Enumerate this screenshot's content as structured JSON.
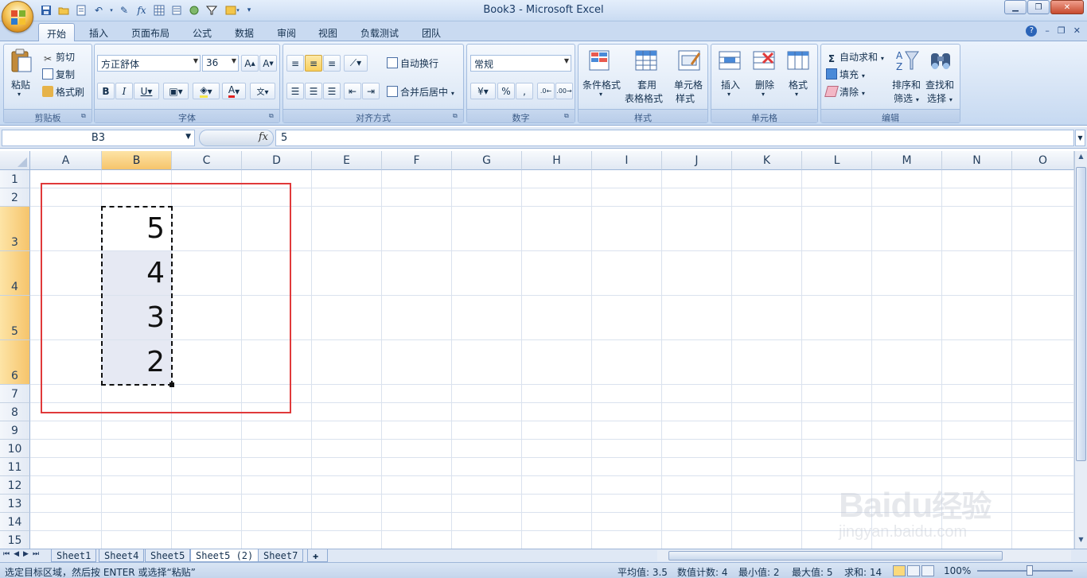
{
  "window": {
    "title": "Book3 - Microsoft Excel"
  },
  "tabs": [
    "开始",
    "插入",
    "页面布局",
    "公式",
    "数据",
    "审阅",
    "视图",
    "负载测试",
    "团队"
  ],
  "clipboard": {
    "paste": "粘贴",
    "cut": "剪切",
    "copy": "复制",
    "format_painter": "格式刷",
    "label": "剪贴板"
  },
  "font": {
    "name": "方正舒体",
    "size": "36",
    "label": "字体"
  },
  "alignment": {
    "wrap": "自动换行",
    "merge": "合并后居中",
    "label": "对齐方式"
  },
  "number": {
    "format": "常规",
    "percent": "%",
    "comma": ",",
    "label": "数字"
  },
  "styles": {
    "conditional": "条件格式",
    "table1": "套用",
    "table2": "表格格式",
    "cell1": "单元格",
    "cell2": "样式",
    "label": "样式"
  },
  "cells": {
    "insert": "插入",
    "delete": "删除",
    "format": "格式",
    "label": "单元格"
  },
  "editing": {
    "autosum": "自动求和",
    "fill": "填充",
    "clear": "清除",
    "sort1": "排序和",
    "sort2": "筛选",
    "find1": "查找和",
    "find2": "选择",
    "label": "编辑"
  },
  "formula_bar": {
    "name_box": "B3",
    "fx": "fx",
    "value": "5"
  },
  "columns": [
    "A",
    "B",
    "C",
    "D",
    "E",
    "F",
    "G",
    "H",
    "I",
    "J",
    "K",
    "L",
    "M",
    "N",
    "O"
  ],
  "rows": [
    "1",
    "2",
    "3",
    "4",
    "5",
    "6",
    "7",
    "8",
    "9",
    "10",
    "11",
    "12",
    "13",
    "14",
    "15"
  ],
  "cell_values": {
    "B3": "5",
    "B4": "4",
    "B5": "3",
    "B6": "2"
  },
  "sheets": [
    "Sheet1",
    "Sheet4",
    "Sheet5",
    "Sheet5 (2)",
    "Sheet7"
  ],
  "active_sheet": "Sheet5 (2)",
  "status": {
    "message": "选定目标区域，然后按 ENTER 或选择“粘贴”",
    "average": "平均值: 3.5",
    "count": "数值计数: 4",
    "min": "最小值: 2",
    "max": "最大值: 5",
    "sum": "求和: 14",
    "zoom": "100%"
  },
  "watermark": {
    "brand": "Baidu",
    "brand2": "经验",
    "sub": "jingyan.baidu.com"
  },
  "colors": {
    "accent": "#f6c46b",
    "ribbon": "#d5e3f5",
    "highlight_box": "#e0393a"
  }
}
